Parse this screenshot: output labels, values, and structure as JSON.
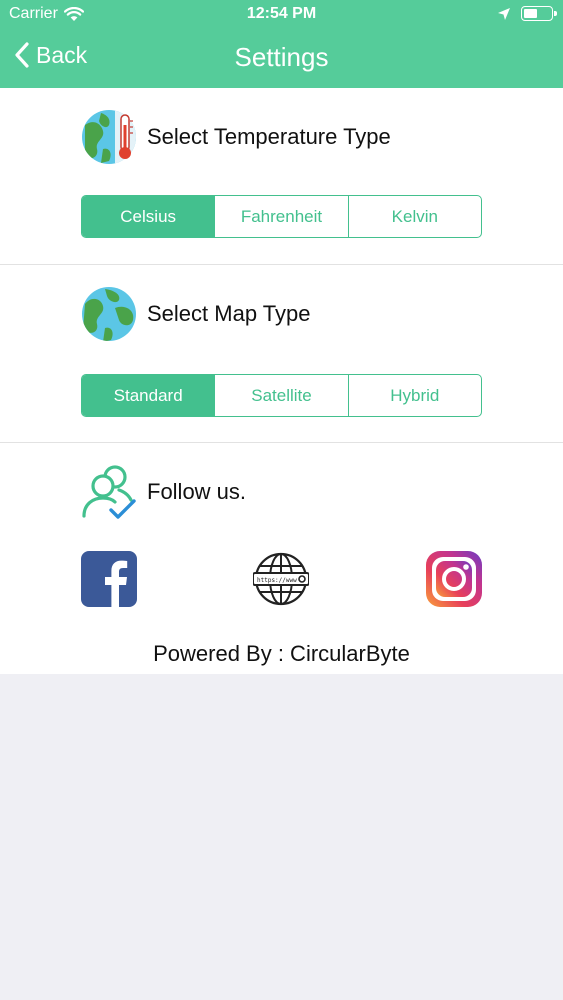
{
  "status_bar": {
    "carrier": "Carrier",
    "time": "12:54 PM"
  },
  "nav": {
    "back_label": "Back",
    "title": "Settings"
  },
  "temperature": {
    "title": "Select Temperature Type",
    "options": [
      "Celsius",
      "Fahrenheit",
      "Kelvin"
    ],
    "selected": "Celsius"
  },
  "map": {
    "title": "Select Map Type",
    "options": [
      "Standard",
      "Satellite",
      "Hybrid"
    ],
    "selected": "Standard"
  },
  "follow": {
    "title": "Follow us.",
    "links": [
      "facebook-icon",
      "website-globe-icon",
      "instagram-icon"
    ],
    "website_icon_text": "https://www"
  },
  "footer": {
    "powered_by": "Powered By : CircularByte"
  },
  "colors": {
    "accent": "#55cc9a",
    "segment_green": "#43c08e",
    "background": "#efeff4"
  }
}
